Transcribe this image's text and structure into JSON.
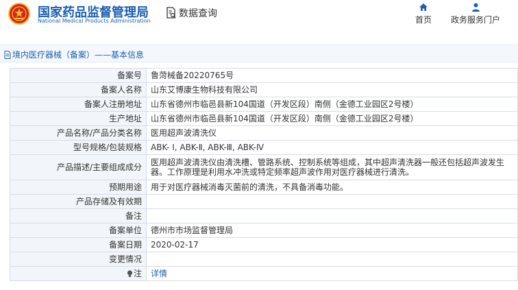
{
  "header": {
    "site_name_cn": "国家药品监督管理局",
    "site_name_en": "National Medical Products Administration",
    "search_label": "数据查询",
    "nav": {
      "home_label": "首页",
      "service_label": "政务服务门户"
    }
  },
  "breadcrumb": {
    "text": "境内医疗器械（备案）——基本信息"
  },
  "record": {
    "rows": [
      {
        "label": "备案号",
        "value": "鲁菏械备20220765号"
      },
      {
        "label": "备案人名称",
        "value": "山东艾博康生物科技有限公司"
      },
      {
        "label": "备案人注册地址",
        "value": "山东省德州市临邑县新104国道（开发区段）南侧（金德工业园区2号楼）"
      },
      {
        "label": "生产地址",
        "value": "山东省德州市临邑县新104国道（开发区段）南侧（金德工业园区2号楼）"
      },
      {
        "label": "产品名称/产品分类名称",
        "value": "医用超声波清洗仪"
      },
      {
        "label": "型号规格/包装规格",
        "value": "ABK- Ⅰ, ABK-Ⅱ, ABK-Ⅲ, ABK-Ⅳ"
      },
      {
        "label": "产品描述/主要组成成分",
        "value": "医用超声波清洗仪由清洗槽、管路系统、控制系统等组成，其中超声清洗器一般还包括超声波发生器。工作原理是利用水冲洗或特定频率超声波作用对医疗器械进行清洗。"
      },
      {
        "label": "预期用途",
        "value": "用于对医疗器械消毒灭菌前的清洗，不具备消毒功能。"
      },
      {
        "label": "产品存储及有效期",
        "value": ""
      },
      {
        "label": "备注",
        "value": ""
      },
      {
        "label": "备案单位",
        "value": "德州市市场监督管理局"
      },
      {
        "label": "备案日期",
        "value": "2020-02-17"
      },
      {
        "label": "变更情况",
        "value": ""
      }
    ],
    "note_label": "注",
    "detail_link": "详情"
  },
  "colors": {
    "brand_blue": "#1b5fb0",
    "label_bg": "#f2f5f9",
    "border": "#d7dde5",
    "emblem_red": "#d7261e",
    "emblem_gold": "#f2c12e"
  },
  "icons": [
    "national-emblem-icon",
    "document-search-icon",
    "home-icon",
    "user-icon",
    "document-icon",
    "lightbulb-icon"
  ]
}
